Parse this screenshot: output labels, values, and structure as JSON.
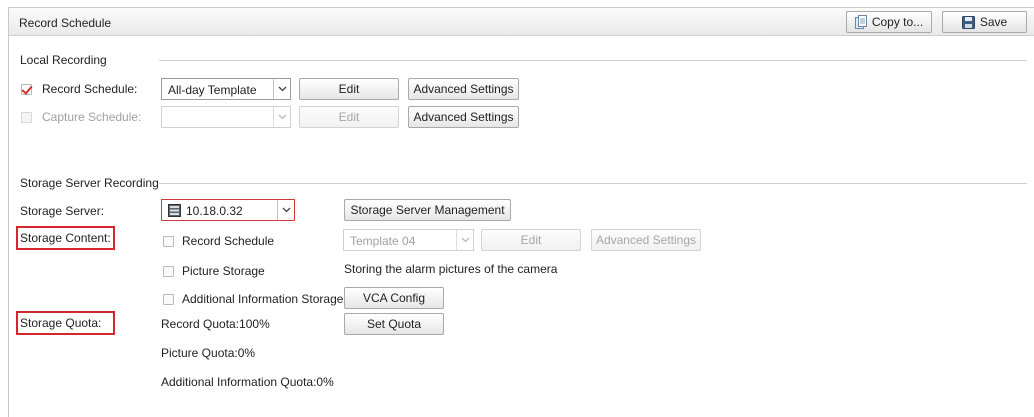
{
  "header": {
    "title": "Record Schedule",
    "copy_label": "Copy to...",
    "save_label": "Save"
  },
  "local": {
    "section_title": "Local Recording",
    "record_schedule": {
      "label": "Record Schedule:",
      "checked": true,
      "template": "All-day Template",
      "edit_label": "Edit",
      "advanced_label": "Advanced Settings"
    },
    "capture_schedule": {
      "label": "Capture Schedule:",
      "checked": false,
      "template": "",
      "edit_label": "Edit",
      "advanced_label": "Advanced Settings"
    }
  },
  "storage": {
    "section_title": "Storage Server Recording",
    "server_label": "Storage Server:",
    "server_value": "10.18.0.32",
    "server_mgmt_label": "Storage Server Management",
    "content_label": "Storage Content:",
    "record_schedule_label": "Record Schedule",
    "template_value": "Template 04",
    "edit_label": "Edit",
    "advanced_label": "Advanced Settings",
    "picture_storage_label": "Picture Storage",
    "picture_note": "Storing the alarm pictures of the camera",
    "additional_label": "Additional Information Storage",
    "vca_label": "VCA Config",
    "quota_label": "Storage Quota:",
    "record_quota": "Record Quota:100%",
    "set_quota_label": "Set Quota",
    "picture_quota": "Picture Quota:0%",
    "additional_quota": "Additional Information Quota:0%"
  },
  "icons": [
    "copy-icon",
    "save-icon",
    "server-icon",
    "chevron-down-icon",
    "checkbox-check-icon"
  ],
  "colors": {
    "highlight_red": "#d4262c",
    "check_red": "#d0302c"
  }
}
